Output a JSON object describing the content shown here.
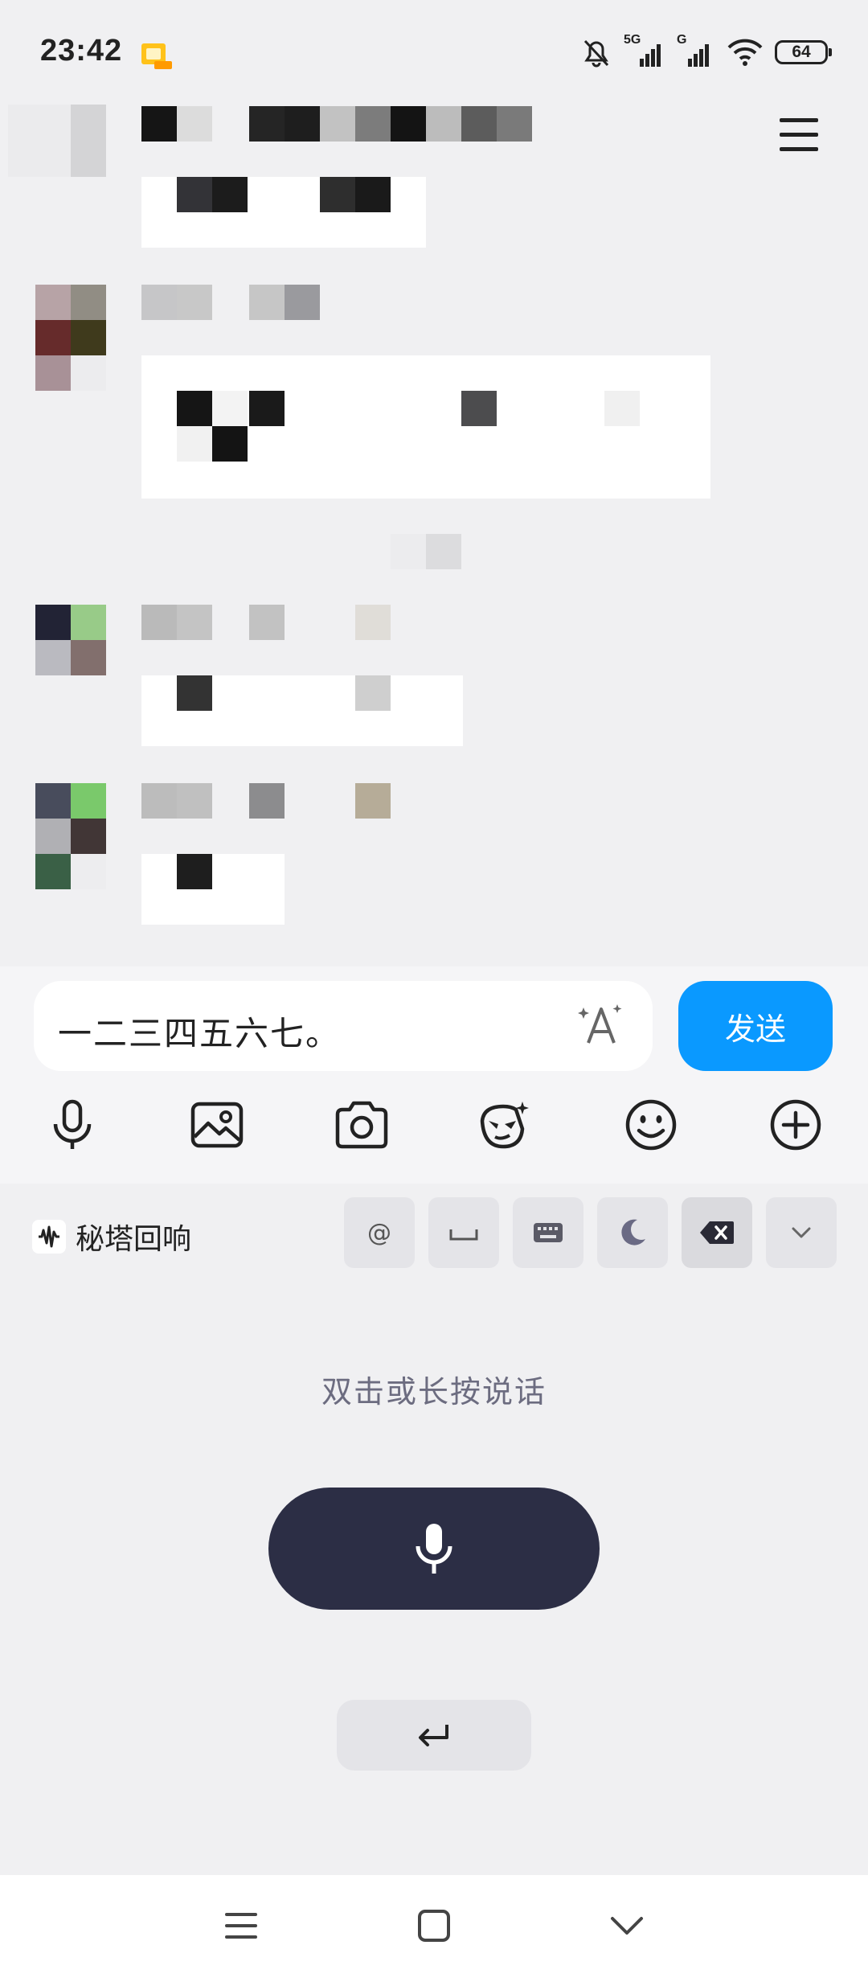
{
  "status_bar": {
    "time": "23:42",
    "network_5g": "5G",
    "network_g": "G",
    "battery": "64"
  },
  "input": {
    "value": "一二三四五六七。",
    "send_label": "发送"
  },
  "keyboard": {
    "brand": "秘塔回响",
    "at_key": "@",
    "voice_hint": "双击或长按说话"
  },
  "colors": {
    "accent": "#0a99ff",
    "mic_button": "#2c2e45",
    "background": "#f0f0f2"
  }
}
